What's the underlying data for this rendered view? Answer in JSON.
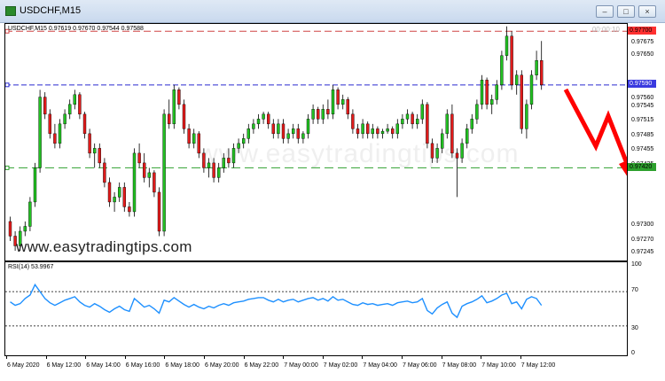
{
  "window": {
    "title": "USDCHF,M15",
    "min_label": "–",
    "restore_label": "□",
    "close_label": "×"
  },
  "main_chart": {
    "info": "USDCHF,M15  0.97619 0.97670 0.97544 0.97588",
    "timer": "00:00:10",
    "watermark": "www.easytradingtips.com",
    "watermark_faint": "www.easytradingtips.com"
  },
  "price_axis": {
    "labels": [
      "0.97675",
      "0.97650",
      "0.97560",
      "0.97545",
      "0.97515",
      "0.97485",
      "0.97455",
      "0.97425",
      "0.97300",
      "0.97270",
      "0.97245"
    ],
    "tag_red": "0.97700",
    "tag_blue": "0.97590",
    "tag_green": "0.97420"
  },
  "rsi": {
    "label": "RSI(14) 53.9967",
    "levels": [
      "100",
      "70",
      "30",
      "0"
    ]
  },
  "time_axis": {
    "labels": [
      "6 May 2020",
      "6 May 12:00",
      "6 May 14:00",
      "6 May 16:00",
      "6 May 18:00",
      "6 May 20:00",
      "6 May 22:00",
      "7 May 00:00",
      "7 May 02:00",
      "7 May 04:00",
      "7 May 06:00",
      "7 May 08:00",
      "7 May 10:00",
      "7 May 12:00"
    ]
  },
  "colors": {
    "bull": "#22c022",
    "bear": "#e01b1b",
    "rsi_line": "#1e90ff",
    "resistance": "#d04545",
    "pivot": "#2a2ad0",
    "support": "#2ea02e",
    "arrow": "#ff0000"
  },
  "candles": [
    [
      0.9731,
      0.9732,
      0.9727,
      0.9728
    ],
    [
      0.9728,
      0.9729,
      0.9725,
      0.9726
    ],
    [
      0.9726,
      0.973,
      0.9725,
      0.9729
    ],
    [
      0.9729,
      0.9731,
      0.9728,
      0.973
    ],
    [
      0.973,
      0.9736,
      0.9729,
      0.9735
    ],
    [
      0.9735,
      0.9743,
      0.9734,
      0.9742
    ],
    [
      0.9742,
      0.9758,
      0.9741,
      0.97565
    ],
    [
      0.97565,
      0.97575,
      0.9752,
      0.9753
    ],
    [
      0.9753,
      0.9754,
      0.9748,
      0.9749
    ],
    [
      0.9749,
      0.9751,
      0.9746,
      0.9747
    ],
    [
      0.9747,
      0.9752,
      0.9746,
      0.9751
    ],
    [
      0.9751,
      0.9754,
      0.975,
      0.9753
    ],
    [
      0.9753,
      0.9756,
      0.9752,
      0.9755
    ],
    [
      0.9755,
      0.9758,
      0.9754,
      0.9757
    ],
    [
      0.9757,
      0.97575,
      0.9752,
      0.9753
    ],
    [
      0.9753,
      0.97535,
      0.9748,
      0.9749
    ],
    [
      0.9749,
      0.975,
      0.9744,
      0.9745
    ],
    [
      0.9745,
      0.9747,
      0.9742,
      0.9746
    ],
    [
      0.9746,
      0.9747,
      0.9742,
      0.9743
    ],
    [
      0.9743,
      0.9744,
      0.9738,
      0.9739
    ],
    [
      0.9739,
      0.974,
      0.9734,
      0.9735
    ],
    [
      0.9735,
      0.9737,
      0.9733,
      0.9736
    ],
    [
      0.9736,
      0.9739,
      0.9735,
      0.9738
    ],
    [
      0.9738,
      0.9739,
      0.9733,
      0.9734
    ],
    [
      0.9734,
      0.9735,
      0.9732,
      0.9733
    ],
    [
      0.9733,
      0.9746,
      0.9732,
      0.9745
    ],
    [
      0.9745,
      0.9747,
      0.9742,
      0.9743
    ],
    [
      0.9743,
      0.9745,
      0.9739,
      0.974
    ],
    [
      0.974,
      0.9742,
      0.9738,
      0.9741
    ],
    [
      0.9741,
      0.97415,
      0.9736,
      0.9737
    ],
    [
      0.9737,
      0.9738,
      0.9728,
      0.9729
    ],
    [
      0.9729,
      0.9754,
      0.9728,
      0.9753
    ],
    [
      0.9753,
      0.9756,
      0.975,
      0.9751
    ],
    [
      0.9751,
      0.9759,
      0.975,
      0.9758
    ],
    [
      0.9758,
      0.97585,
      0.9754,
      0.9755
    ],
    [
      0.9755,
      0.9756,
      0.9749,
      0.975
    ],
    [
      0.975,
      0.9751,
      0.9746,
      0.9747
    ],
    [
      0.9747,
      0.975,
      0.9746,
      0.9749
    ],
    [
      0.9749,
      0.97495,
      0.9744,
      0.9745
    ],
    [
      0.9745,
      0.9746,
      0.9741,
      0.9742
    ],
    [
      0.9742,
      0.9744,
      0.974,
      0.9743
    ],
    [
      0.9743,
      0.9744,
      0.9739,
      0.974
    ],
    [
      0.974,
      0.9743,
      0.9739,
      0.9742
    ],
    [
      0.9742,
      0.9745,
      0.9741,
      0.9744
    ],
    [
      0.9744,
      0.9746,
      0.9742,
      0.9743
    ],
    [
      0.9743,
      0.9747,
      0.9742,
      0.9746
    ],
    [
      0.9746,
      0.9748,
      0.9745,
      0.9747
    ],
    [
      0.9747,
      0.9749,
      0.9746,
      0.9748
    ],
    [
      0.9748,
      0.9751,
      0.9747,
      0.975
    ],
    [
      0.975,
      0.9752,
      0.9749,
      0.9751
    ],
    [
      0.9751,
      0.9753,
      0.975,
      0.9752
    ],
    [
      0.9752,
      0.97535,
      0.9751,
      0.9753
    ],
    [
      0.9753,
      0.97535,
      0.975,
      0.9751
    ],
    [
      0.9751,
      0.9752,
      0.9748,
      0.9749
    ],
    [
      0.9749,
      0.9752,
      0.9748,
      0.9751
    ],
    [
      0.9751,
      0.9752,
      0.9747,
      0.9748
    ],
    [
      0.9748,
      0.975,
      0.9747,
      0.9749
    ],
    [
      0.9749,
      0.9751,
      0.9748,
      0.975
    ],
    [
      0.975,
      0.9751,
      0.9747,
      0.9748
    ],
    [
      0.9748,
      0.97495,
      0.9747,
      0.9749
    ],
    [
      0.9749,
      0.9753,
      0.9748,
      0.9752
    ],
    [
      0.9752,
      0.9755,
      0.9751,
      0.9754
    ],
    [
      0.9754,
      0.97545,
      0.9751,
      0.9752
    ],
    [
      0.9752,
      0.9755,
      0.9751,
      0.9754
    ],
    [
      0.9754,
      0.9756,
      0.9752,
      0.9753
    ],
    [
      0.9753,
      0.9759,
      0.9752,
      0.9758
    ],
    [
      0.9758,
      0.97585,
      0.9754,
      0.9755
    ],
    [
      0.9755,
      0.9757,
      0.9754,
      0.9756
    ],
    [
      0.9756,
      0.97565,
      0.9752,
      0.9753
    ],
    [
      0.9753,
      0.9754,
      0.9749,
      0.975
    ],
    [
      0.975,
      0.9751,
      0.9748,
      0.9749
    ],
    [
      0.9749,
      0.9752,
      0.9748,
      0.9751
    ],
    [
      0.9751,
      0.97515,
      0.9748,
      0.9749
    ],
    [
      0.9749,
      0.9751,
      0.9748,
      0.975
    ],
    [
      0.975,
      0.97505,
      0.9748,
      0.9749
    ],
    [
      0.9749,
      0.975,
      0.9748,
      0.97495
    ],
    [
      0.97495,
      0.9751,
      0.9749,
      0.975
    ],
    [
      0.975,
      0.97505,
      0.9748,
      0.9749
    ],
    [
      0.9749,
      0.9752,
      0.9748,
      0.9751
    ],
    [
      0.9751,
      0.9753,
      0.975,
      0.9752
    ],
    [
      0.9752,
      0.9754,
      0.9751,
      0.9753
    ],
    [
      0.9753,
      0.97535,
      0.975,
      0.9751
    ],
    [
      0.9751,
      0.9753,
      0.975,
      0.9752
    ],
    [
      0.9752,
      0.9756,
      0.9751,
      0.9755
    ],
    [
      0.9755,
      0.97555,
      0.9746,
      0.9747
    ],
    [
      0.9747,
      0.9748,
      0.9743,
      0.9744
    ],
    [
      0.9744,
      0.9747,
      0.9743,
      0.9746
    ],
    [
      0.9746,
      0.975,
      0.9745,
      0.9749
    ],
    [
      0.9749,
      0.9754,
      0.9748,
      0.9753
    ],
    [
      0.9753,
      0.9755,
      0.9744,
      0.9745
    ],
    [
      0.9745,
      0.9746,
      0.9736,
      0.9744
    ],
    [
      0.9744,
      0.9748,
      0.9743,
      0.9747
    ],
    [
      0.9747,
      0.9751,
      0.9746,
      0.975
    ],
    [
      0.975,
      0.9753,
      0.9749,
      0.9752
    ],
    [
      0.9752,
      0.9756,
      0.9751,
      0.9755
    ],
    [
      0.9755,
      0.9761,
      0.9754,
      0.976
    ],
    [
      0.976,
      0.97605,
      0.9754,
      0.9755
    ],
    [
      0.9755,
      0.9757,
      0.9753,
      0.9756
    ],
    [
      0.9756,
      0.976,
      0.9755,
      0.9759
    ],
    [
      0.9759,
      0.9766,
      0.9758,
      0.9765
    ],
    [
      0.9765,
      0.9771,
      0.9764,
      0.9769
    ],
    [
      0.9769,
      0.977,
      0.9758,
      0.9759
    ],
    [
      0.9759,
      0.9762,
      0.9757,
      0.9761
    ],
    [
      0.9761,
      0.9762,
      0.9749,
      0.975
    ],
    [
      0.975,
      0.9756,
      0.9748,
      0.9755
    ],
    [
      0.9755,
      0.9762,
      0.9754,
      0.9761
    ],
    [
      0.9761,
      0.9766,
      0.976,
      0.9764
    ],
    [
      0.9764,
      0.9768,
      0.9758,
      0.9759
    ]
  ],
  "rsi_values": [
    58,
    54,
    56,
    62,
    66,
    78,
    70,
    62,
    57,
    54,
    57,
    60,
    62,
    64,
    58,
    54,
    52,
    56,
    53,
    49,
    46,
    50,
    53,
    49,
    47,
    62,
    57,
    52,
    54,
    50,
    45,
    60,
    58,
    63,
    59,
    55,
    52,
    55,
    52,
    50,
    53,
    51,
    54,
    56,
    54,
    57,
    58,
    59,
    61,
    62,
    63,
    63,
    60,
    58,
    61,
    58,
    60,
    61,
    58,
    60,
    62,
    63,
    60,
    62,
    59,
    64,
    60,
    61,
    58,
    55,
    54,
    57,
    55,
    56,
    54,
    55,
    56,
    54,
    57,
    58,
    59,
    57,
    58,
    62,
    48,
    44,
    51,
    55,
    58,
    45,
    40,
    53,
    56,
    58,
    61,
    65,
    57,
    59,
    62,
    66,
    68,
    56,
    58,
    50,
    61,
    64,
    62,
    54
  ]
}
